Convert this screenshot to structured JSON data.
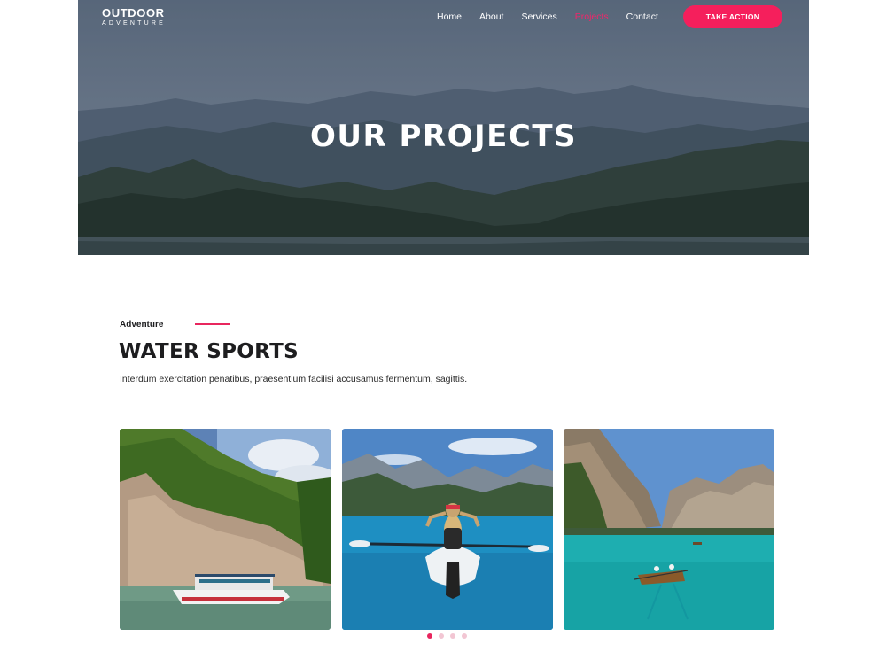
{
  "brand": {
    "line1": "OUTDOOR",
    "line2": "ADVENTURE"
  },
  "nav": {
    "items": [
      {
        "label": "Home",
        "active": false
      },
      {
        "label": "About",
        "active": false
      },
      {
        "label": "Services",
        "active": false
      },
      {
        "label": "Projects",
        "active": true
      },
      {
        "label": "Contact",
        "active": false
      }
    ],
    "cta_label": "TAKE ACTION"
  },
  "hero": {
    "title": "OUR PROJECTS"
  },
  "section": {
    "eyebrow": "Adventure",
    "title": "WATER SPORTS",
    "description": "Interdum exercitation penatibus, praesentium facilisi accusamus fermentum, sagittis."
  },
  "gallery": {
    "cards": [
      {
        "subject": "tour-boat-by-cliffs"
      },
      {
        "subject": "kayaker-in-lake"
      },
      {
        "subject": "rowboat-in-mountain-lake"
      }
    ],
    "dots": 4,
    "active_dot": 1
  },
  "colors": {
    "accent": "#f51f5c",
    "accent_line": "#e8265e",
    "text": "#1d1d1f"
  }
}
